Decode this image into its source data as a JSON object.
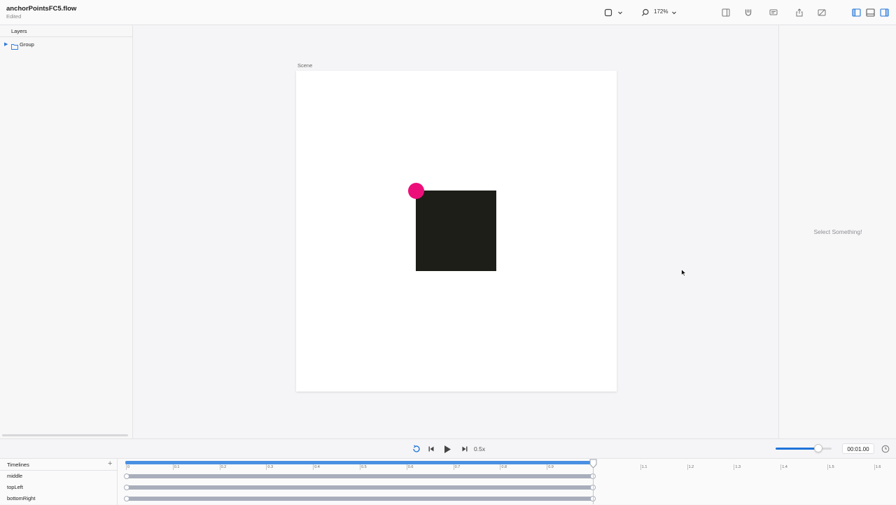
{
  "document": {
    "title": "anchorPointsFC5.flow",
    "status": "Edited"
  },
  "toolbar": {
    "zoom": "172%"
  },
  "layers": {
    "header": "Layers",
    "items": [
      {
        "label": "Group"
      }
    ]
  },
  "canvas": {
    "scene_label": "Scene"
  },
  "inspector": {
    "empty_message": "Select Something!"
  },
  "playback": {
    "speed": "0.5x",
    "time": "00:01.00",
    "volume": 0.76
  },
  "timelines": {
    "header": "Timelines",
    "ruler_labels": [
      "0",
      "0.1",
      "0.2",
      "0.3",
      "0.4",
      "0.5",
      "0.6",
      "0.7",
      "0.8",
      "0.9",
      "1.1",
      "1.2",
      "1.3",
      "1.4",
      "1.5",
      "1.6"
    ],
    "tracks": [
      {
        "name": "middle"
      },
      {
        "name": "topLeft"
      },
      {
        "name": "bottomRight"
      }
    ]
  },
  "colors": {
    "accent": "#1f73d8",
    "anchor_dot": "#ec0f7a",
    "square": "#1e1e18",
    "track_bar": "#a8aebb"
  }
}
